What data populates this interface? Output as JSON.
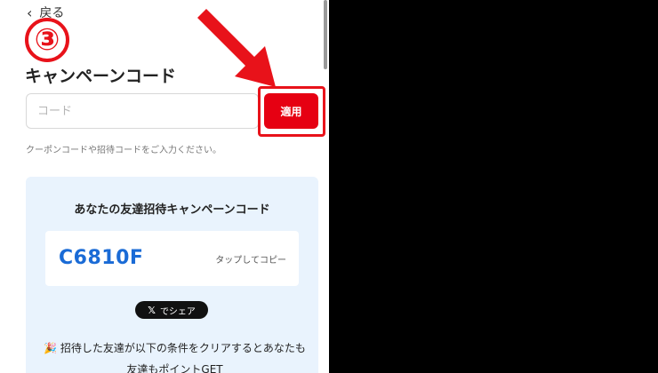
{
  "nav": {
    "back_label": "戻る"
  },
  "step_badge": "③",
  "campaign": {
    "title": "キャンペーンコード",
    "input_placeholder": "コード",
    "input_value": "",
    "apply_label": "適用",
    "hint": "クーポンコードや招待コードをご入力ください。"
  },
  "invite": {
    "heading": "あなたの友達招待キャンペーンコード",
    "code": "C6810F",
    "copy_label": "タップしてコピー",
    "share_label": "でシェア",
    "share_logo": "𝕏",
    "conditions_emoji": "🎉",
    "conditions_text": "招待した友達が以下の条件をクリアするとあなたも友達もポイントGET"
  },
  "colors": {
    "accent_red": "#e60012",
    "code_blue": "#1a6bd6",
    "card_bg": "#e9f3fd"
  }
}
